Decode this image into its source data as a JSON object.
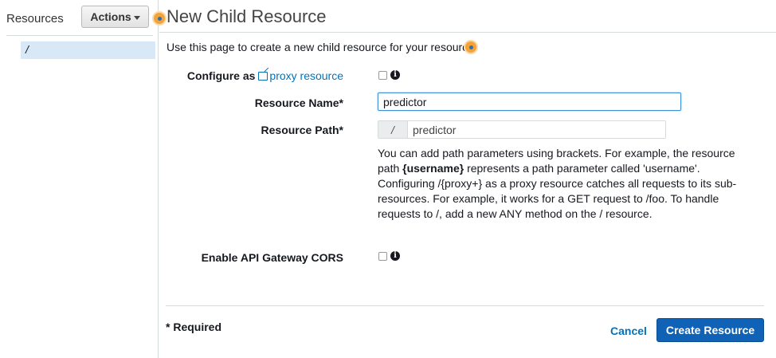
{
  "sidebar": {
    "title": "Resources",
    "actions_label": "Actions",
    "tree": [
      {
        "path": "/"
      }
    ]
  },
  "main": {
    "title": "New Child Resource",
    "intro": "Use this page to create a new child resource for your resource."
  },
  "form": {
    "configure_proxy": {
      "label_prefix": "Configure as",
      "link_text": "proxy resource",
      "checked": false
    },
    "resource_name": {
      "label": "Resource Name*",
      "value": "predictor"
    },
    "resource_path": {
      "label": "Resource Path*",
      "prefix": "/",
      "value": "predictor"
    },
    "help": {
      "part1": "You can add path parameters using brackets. For example, the resource path ",
      "bold": "{username}",
      "part2": " represents a path parameter called 'username'. Configuring /{proxy+} as a proxy resource catches all requests to its sub-resources. For example, it works for a GET request to /foo. To handle requests to /, add a new ANY method on the / resource."
    },
    "cors": {
      "label": "Enable API Gateway CORS",
      "checked": false
    }
  },
  "footer": {
    "required_note": "* Required",
    "cancel_label": "Cancel",
    "create_label": "Create Resource"
  },
  "colors": {
    "primary_button": "#0f62b5",
    "link": "#0073bb",
    "selected_tree_item": "#d8e8f7",
    "help_dot": "#f2a33a"
  }
}
